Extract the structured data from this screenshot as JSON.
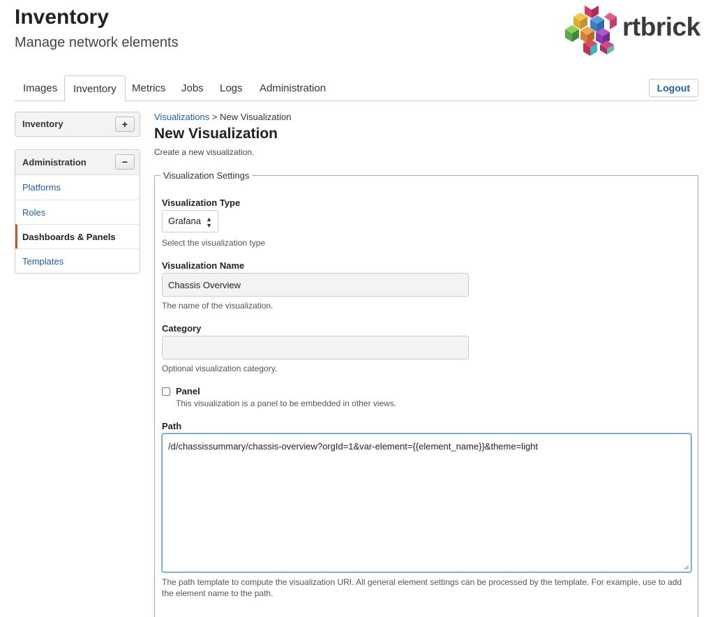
{
  "header": {
    "title": "Inventory",
    "subtitle": "Manage network elements",
    "logo_text": "rtbrick"
  },
  "tabs": [
    {
      "label": "Images"
    },
    {
      "label": "Inventory"
    },
    {
      "label": "Metrics"
    },
    {
      "label": "Jobs"
    },
    {
      "label": "Logs"
    },
    {
      "label": "Administration"
    }
  ],
  "active_tab": "Inventory",
  "logout_label": "Logout",
  "sidebar": {
    "inventory": {
      "title": "Inventory",
      "toggle": "+"
    },
    "administration": {
      "title": "Administration",
      "toggle": "−",
      "items": [
        {
          "label": "Platforms"
        },
        {
          "label": "Roles"
        },
        {
          "label": "Dashboards & Panels"
        },
        {
          "label": "Templates"
        }
      ]
    }
  },
  "breadcrumb": {
    "parent": "Visualizations",
    "separator": ">",
    "current": "New Visualization"
  },
  "main": {
    "title": "New Visualization",
    "description": "Create a new visualization.",
    "fieldset_legend": "Visualization Settings",
    "type": {
      "label": "Visualization Type",
      "value": "Grafana",
      "help": "Select the visualization type"
    },
    "name": {
      "label": "Visualization Name",
      "value": "Chassis Overview",
      "help": "The name of the visualization."
    },
    "category": {
      "label": "Category",
      "value": "",
      "help": "Optional visualization category."
    },
    "panel": {
      "label": "Panel",
      "checked": false,
      "help": "This visualization is a panel to be embedded in other views."
    },
    "path": {
      "label": "Path",
      "value": "/d/chassissummary/chassis-overview?orgId=1&var-element={{element_name}}&theme=light",
      "help": "The path template to compute the visualization URI. All general element settings can be processed by the template. For example, use to add the element name to the path."
    }
  },
  "colors": {
    "link": "#1f5fa9",
    "active_marker": "#c45a2b",
    "focus": "#5b9bd5"
  }
}
